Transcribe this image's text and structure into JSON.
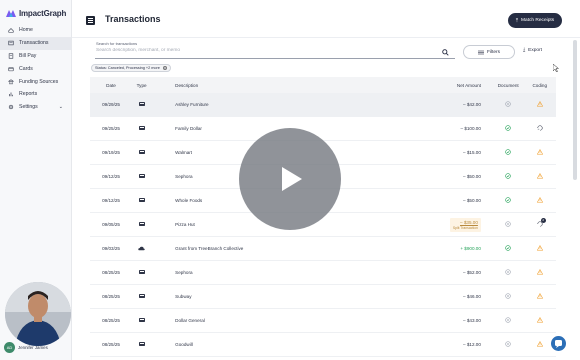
{
  "app": {
    "name": "ImpactGraph"
  },
  "sidebar": {
    "items": [
      {
        "label": "Home",
        "icon": "home-icon"
      },
      {
        "label": "Transactions",
        "icon": "transactions-icon",
        "active": true
      },
      {
        "label": "Bill Pay",
        "icon": "bill-pay-icon"
      },
      {
        "label": "Cards",
        "icon": "card-icon"
      },
      {
        "label": "Funding Sources",
        "icon": "bank-icon"
      },
      {
        "label": "Reports",
        "icon": "reports-icon"
      },
      {
        "label": "Settings",
        "icon": "gear-icon",
        "has_chevron": true
      }
    ]
  },
  "header": {
    "title": "Transactions",
    "match_receipts_label": "Match Receipts"
  },
  "toolbar": {
    "search_label": "Search for transactions",
    "search_placeholder": "Search description, merchant, or memo",
    "filters_label": "Filters",
    "export_label": "Export",
    "status_filter_chip": "Status: Canceled, Processing +2 more"
  },
  "table": {
    "columns": [
      "Date",
      "Type",
      "Description",
      "Net Amount",
      "Document",
      "Coding"
    ],
    "rows": [
      {
        "date": "09/29/25",
        "type": "card",
        "description": "Ashley Furniture",
        "amount": "– $42.00",
        "document": "plus",
        "coding": "warning",
        "highlight": true
      },
      {
        "date": "09/25/25",
        "type": "card",
        "description": "Family Dollar",
        "amount": "– $100.00",
        "document": "check",
        "coding": "partial"
      },
      {
        "date": "09/19/25",
        "type": "card",
        "description": "Walmart",
        "amount": "– $15.00",
        "document": "check",
        "coding": "warning"
      },
      {
        "date": "09/12/25",
        "type": "card",
        "description": "Sephora",
        "amount": "– $50.00",
        "document": "check",
        "coding": "warning"
      },
      {
        "date": "09/12/25",
        "type": "card",
        "description": "Whole Foods",
        "amount": "– $50.00",
        "document": "check",
        "coding": "warning"
      },
      {
        "date": "09/05/25",
        "type": "card",
        "description": "Pizza Hut",
        "amount": "– $35.00",
        "amount_note": "Split Transaction",
        "document": "plus",
        "coding": "partial-badge",
        "badge": "2"
      },
      {
        "date": "09/03/25",
        "type": "cloud",
        "description": "Grant from TreeBranch Collective",
        "amount": "+ $900.00",
        "positive": true,
        "document": "check",
        "coding": "warning"
      },
      {
        "date": "08/25/25",
        "type": "card",
        "description": "Sephora",
        "amount": "– $52.00",
        "document": "plus",
        "coding": "warning"
      },
      {
        "date": "08/25/25",
        "type": "card",
        "description": "Subway",
        "amount": "– $46.00",
        "document": "plus",
        "coding": "warning"
      },
      {
        "date": "08/25/25",
        "type": "card",
        "description": "Dollar General",
        "amount": "– $43.00",
        "document": "plus",
        "coding": "warning"
      },
      {
        "date": "08/25/25",
        "type": "card",
        "description": "Goodwill",
        "amount": "– $12.00",
        "document": "plus",
        "coding": "warning"
      }
    ]
  },
  "presenter": {
    "initials": "AD",
    "name": "Jennifer James"
  },
  "colors": {
    "accent_dark": "#262d43",
    "positive": "#26a35a",
    "warning": "#f0a030",
    "split_bg": "#fdf3e3"
  }
}
